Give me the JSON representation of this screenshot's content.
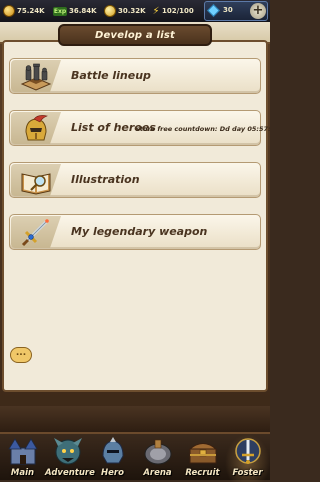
{
  "resources": {
    "gold": "75.24K",
    "exp_badge": "Exp",
    "exp": "36.84K",
    "coins": "30.32K",
    "stamina": "102/100",
    "diamonds": "30",
    "add_label": "+"
  },
  "panel": {
    "title": "Develop a list",
    "chat_label": "..."
  },
  "rows": [
    {
      "label": "Battle lineup",
      "icon": "chessboard-icon"
    },
    {
      "label": "List of heroes",
      "extra": "store free countdown: Dd day 05:57:",
      "icon": "helmet-icon"
    },
    {
      "label": "Illustration",
      "icon": "book-icon"
    },
    {
      "label": "My legendary weapon",
      "icon": "sword-icon"
    }
  ],
  "nav": [
    {
      "label": "Main"
    },
    {
      "label": "Adventure"
    },
    {
      "label": "Hero"
    },
    {
      "label": "Arena"
    },
    {
      "label": "Recruit"
    },
    {
      "label": "Foster",
      "active": true
    }
  ],
  "colors": {
    "panel_bg": "#f1ead9",
    "title_plate": "#5a3d24",
    "label_text": "#4a3420",
    "nav_text": "#f5e6c3"
  }
}
